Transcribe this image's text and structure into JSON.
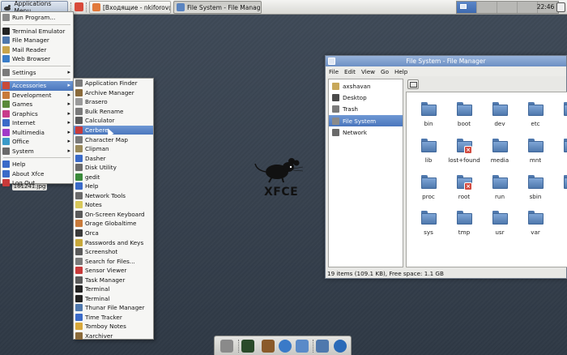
{
  "top_panel": {
    "apps_menu_label": "Applications Menu",
    "tasks": [
      {
        "label": "[Входящие - nkiforov@...",
        "icon_color": "#e2793a"
      },
      {
        "label": "File System - File Manager",
        "icon_color": "#5a84c0"
      }
    ],
    "clock": "22:46",
    "workspace_count": 5,
    "current_workspace": 1
  },
  "main_menu": {
    "items": [
      {
        "label": "Run Program...",
        "icon": "run-icon",
        "color": "#8a8a8a",
        "submenu": false
      },
      {
        "separator": true
      },
      {
        "label": "Terminal Emulator",
        "icon": "terminal-icon",
        "color": "#222222",
        "submenu": false
      },
      {
        "label": "File Manager",
        "icon": "file-manager-icon",
        "color": "#4f78ad",
        "submenu": false
      },
      {
        "label": "Mail Reader",
        "icon": "mail-icon",
        "color": "#c9a44a",
        "submenu": false
      },
      {
        "label": "Web Browser",
        "icon": "globe-icon",
        "color": "#3a7dc8",
        "submenu": false
      },
      {
        "separator": true
      },
      {
        "label": "Settings",
        "icon": "settings-icon",
        "color": "#7a7a7a",
        "submenu": true
      },
      {
        "separator": true
      },
      {
        "label": "Accessories",
        "icon": "accessories-icon",
        "color": "#c84a3a",
        "submenu": true,
        "highlighted": true
      },
      {
        "label": "Development",
        "icon": "development-icon",
        "color": "#c87a3a",
        "submenu": true
      },
      {
        "label": "Games",
        "icon": "games-icon",
        "color": "#5a8a3a",
        "submenu": true
      },
      {
        "label": "Graphics",
        "icon": "graphics-icon",
        "color": "#c83a8a",
        "submenu": true
      },
      {
        "label": "Internet",
        "icon": "internet-icon",
        "color": "#3a6ac8",
        "submenu": true
      },
      {
        "label": "Multimedia",
        "icon": "multimedia-icon",
        "color": "#a03ac8",
        "submenu": true
      },
      {
        "label": "Office",
        "icon": "office-icon",
        "color": "#3a9ac8",
        "submenu": true
      },
      {
        "label": "System",
        "icon": "system-icon",
        "color": "#6a6a6a",
        "submenu": true
      },
      {
        "separator": true
      },
      {
        "label": "Help",
        "icon": "help-icon",
        "color": "#3a6ac8",
        "submenu": false
      },
      {
        "label": "About Xfce",
        "icon": "about-icon",
        "color": "#3a6ac8",
        "submenu": false
      },
      {
        "label": "Log Out",
        "icon": "logout-icon",
        "color": "#c83a3a",
        "submenu": false
      }
    ]
  },
  "accessories_menu": {
    "items": [
      {
        "label": "Application Finder",
        "icon": "app-finder-icon",
        "color": "#7a7a7a"
      },
      {
        "label": "Archive Manager",
        "icon": "archive-icon",
        "color": "#8a6a3a"
      },
      {
        "label": "Brasero",
        "icon": "disc-icon",
        "color": "#9a9a9a"
      },
      {
        "label": "Bulk Rename",
        "icon": "rename-icon",
        "color": "#7a7a7a"
      },
      {
        "label": "Calculator",
        "icon": "calculator-icon",
        "color": "#5a5a5a"
      },
      {
        "label": "Cerbere",
        "icon": "cerbere-icon",
        "color": "#c83a3a",
        "highlighted": true
      },
      {
        "label": "Character Map",
        "icon": "charmap-icon",
        "color": "#7a7a7a"
      },
      {
        "label": "Clipman",
        "icon": "clipboard-icon",
        "color": "#9a8a5a"
      },
      {
        "label": "Dasher",
        "icon": "dasher-icon",
        "color": "#3a6ac8"
      },
      {
        "label": "Disk Utility",
        "icon": "disk-icon",
        "color": "#6a6a6a"
      },
      {
        "label": "gedit",
        "icon": "text-editor-icon",
        "color": "#3a8a3a"
      },
      {
        "label": "Help",
        "icon": "help-icon",
        "color": "#3a6ac8"
      },
      {
        "label": "Network Tools",
        "icon": "network-icon",
        "color": "#6a6a6a"
      },
      {
        "label": "Notes",
        "icon": "notes-icon",
        "color": "#d8c85a"
      },
      {
        "label": "On-Screen Keyboard",
        "icon": "keyboard-icon",
        "color": "#5a5a5a"
      },
      {
        "label": "Orage Globaltime",
        "icon": "globaltime-icon",
        "color": "#c87a3a"
      },
      {
        "label": "Orca",
        "icon": "orca-icon",
        "color": "#3a3a3a"
      },
      {
        "label": "Passwords and Keys",
        "icon": "keys-icon",
        "color": "#c8a83a"
      },
      {
        "label": "Screenshot",
        "icon": "screenshot-icon",
        "color": "#5a5a5a"
      },
      {
        "label": "Search for Files...",
        "icon": "search-icon",
        "color": "#7a7a7a"
      },
      {
        "label": "Sensor Viewer",
        "icon": "sensor-icon",
        "color": "#c83a3a"
      },
      {
        "label": "Task Manager",
        "icon": "task-manager-icon",
        "color": "#5a5a5a"
      },
      {
        "label": "Terminal",
        "icon": "terminal-icon",
        "color": "#222222"
      },
      {
        "label": "Terminal",
        "icon": "terminal-icon",
        "color": "#222222"
      },
      {
        "label": "Thunar File Manager",
        "icon": "file-manager-icon",
        "color": "#4f78ad"
      },
      {
        "label": "Time Tracker",
        "icon": "time-tracker-icon",
        "color": "#3a6ac8"
      },
      {
        "label": "Tomboy Notes",
        "icon": "tomboy-icon",
        "color": "#d8a83a"
      },
      {
        "label": "Xarchiver",
        "icon": "xarchiver-icon",
        "color": "#8a6a3a"
      }
    ]
  },
  "desktop": {
    "file_label": "161241.jpg",
    "logo_text": "XFCE"
  },
  "file_manager": {
    "title": "File System - File Manager",
    "menubar": [
      "File",
      "Edit",
      "View",
      "Go",
      "Help"
    ],
    "sidebar": [
      {
        "label": "axshavan",
        "icon": "home-folder-icon",
        "color": "#c8a85a"
      },
      {
        "label": "Desktop",
        "icon": "desktop-icon",
        "color": "#4a4a4a"
      },
      {
        "label": "Trash",
        "icon": "trash-icon",
        "color": "#7a7a7a"
      },
      {
        "label": "File System",
        "icon": "drive-icon",
        "color": "#8a8a8a",
        "highlighted": true
      },
      {
        "label": "Network",
        "icon": "network-icon",
        "color": "#6a6a6a"
      }
    ],
    "folders": [
      {
        "name": "bin"
      },
      {
        "name": "boot"
      },
      {
        "name": "dev"
      },
      {
        "name": "etc"
      },
      {
        "name": "h"
      },
      {
        "name": "lib"
      },
      {
        "name": "lost+found",
        "locked": true
      },
      {
        "name": "media"
      },
      {
        "name": "mnt"
      },
      {
        "name": ""
      },
      {
        "name": "proc"
      },
      {
        "name": "root",
        "locked": true
      },
      {
        "name": "run"
      },
      {
        "name": "sbin"
      },
      {
        "name": ""
      },
      {
        "name": "sys"
      },
      {
        "name": "tmp"
      },
      {
        "name": "usr"
      },
      {
        "name": "var"
      }
    ],
    "status": "19 items (109.1 KB), Free space: 1.1 GB"
  },
  "dock": {
    "items": [
      {
        "name": "show-desktop-icon",
        "color": "#8a8a8a"
      },
      {
        "name": "terminal-icon",
        "color": "#2a4a2a"
      },
      {
        "name": "text-editor-icon",
        "color": "#8a5a2a"
      },
      {
        "name": "browser-icon",
        "color": "#3a7ac8"
      },
      {
        "name": "search-icon",
        "color": "#5a8ac8"
      },
      {
        "name": "file-manager-icon",
        "color": "#4f78ad"
      },
      {
        "name": "globe-icon",
        "color": "#2a6ab8"
      }
    ]
  }
}
